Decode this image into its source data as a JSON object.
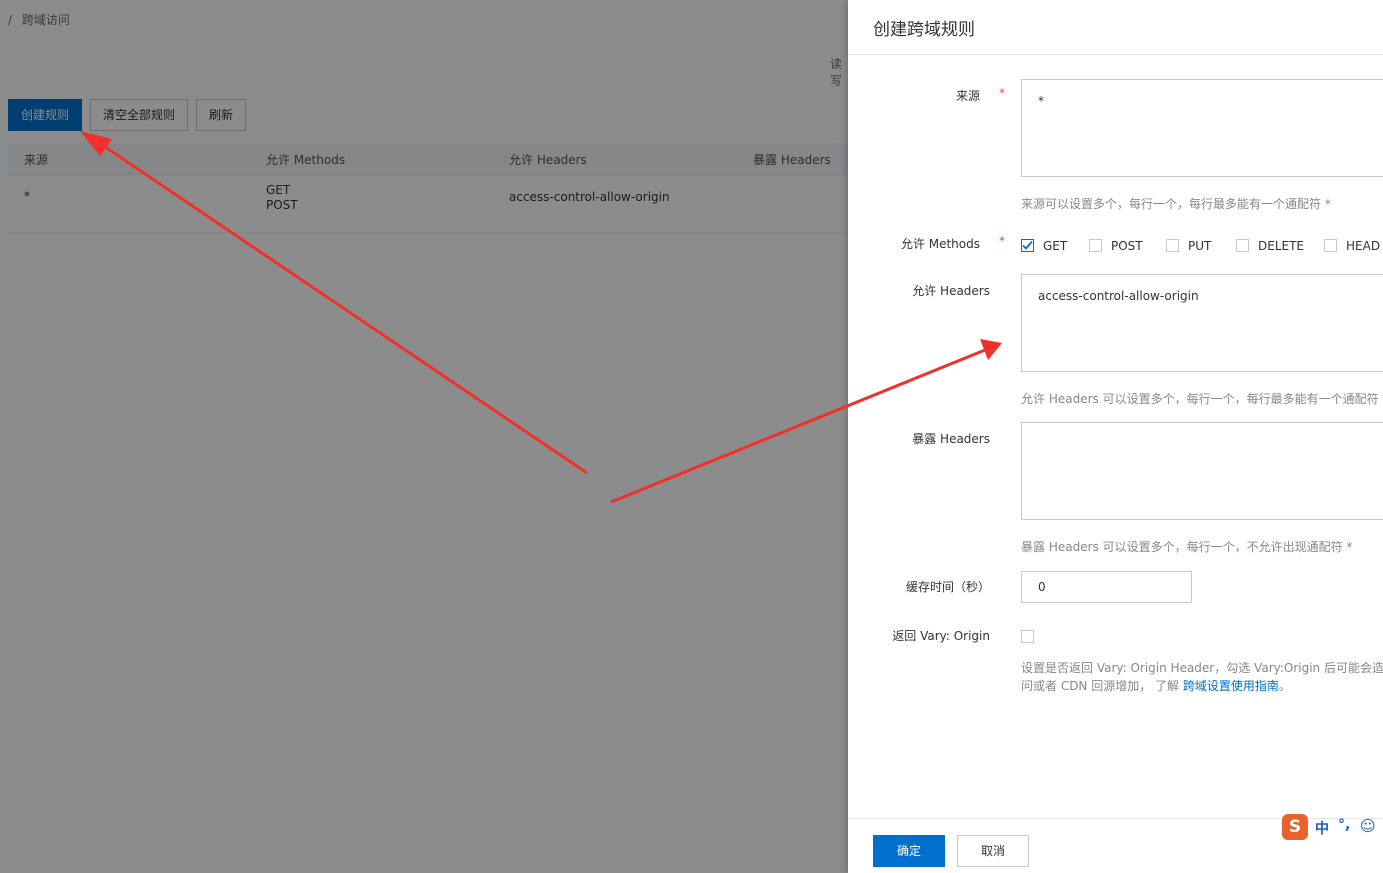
{
  "background": {
    "breadcrumb": {
      "separator": "/",
      "current": "跨域访问"
    },
    "reading_text": "读写",
    "buttons": {
      "create": "创建规则",
      "clear_all": "清空全部规则",
      "refresh": "刷新"
    },
    "table": {
      "columns": [
        "来源",
        "允许 Methods",
        "允许 Headers",
        "暴露 Headers"
      ],
      "rows": [
        {
          "origin": "*",
          "methods": [
            "GET",
            "POST"
          ],
          "allow_headers": "access-control-allow-origin",
          "expose_headers": ""
        }
      ]
    }
  },
  "drawer": {
    "title": "创建跨域规则",
    "origin": {
      "label": "来源",
      "required_mark": "*",
      "value": "*",
      "hint": "来源可以设置多个，每行一个，每行最多能有一个通配符 *"
    },
    "methods": {
      "label": "允许 Methods",
      "required_mark": "*",
      "options": [
        {
          "label": "GET",
          "checked": true
        },
        {
          "label": "POST",
          "checked": false
        },
        {
          "label": "PUT",
          "checked": false
        },
        {
          "label": "DELETE",
          "checked": false
        },
        {
          "label": "HEAD",
          "checked": false
        }
      ]
    },
    "allow_headers": {
      "label": "允许 Headers",
      "value": "access-control-allow-origin",
      "hint": "允许 Headers 可以设置多个，每行一个，每行最多能有一个通配符 *"
    },
    "expose_headers": {
      "label": "暴露 Headers",
      "value": "",
      "hint": "暴露 Headers 可以设置多个，每行一个，不允许出现通配符 *"
    },
    "cache_time": {
      "label": "缓存时间（秒）",
      "value": "0"
    },
    "vary_origin": {
      "label": "返回 Vary: Origin",
      "checked": false,
      "hint_line1": "设置是否返回 Vary: Origin Header，勾选 Vary:Origin 后可能会造成",
      "hint_line2_prefix": "问或者 CDN 回源增加， 了解 ",
      "hint_link": "跨域设置使用指南",
      "hint_line2_suffix": "。"
    },
    "buttons": {
      "confirm": "确定",
      "cancel": "取消"
    }
  },
  "ime_toolbar": {
    "logo": "S",
    "mode": "中",
    "punct": "°,",
    "emoji": "☺"
  },
  "colors": {
    "primary": "#0070cc",
    "annotation_arrow": "#f0302a",
    "required": "#e84738",
    "ime_brand": "#e8622a"
  }
}
